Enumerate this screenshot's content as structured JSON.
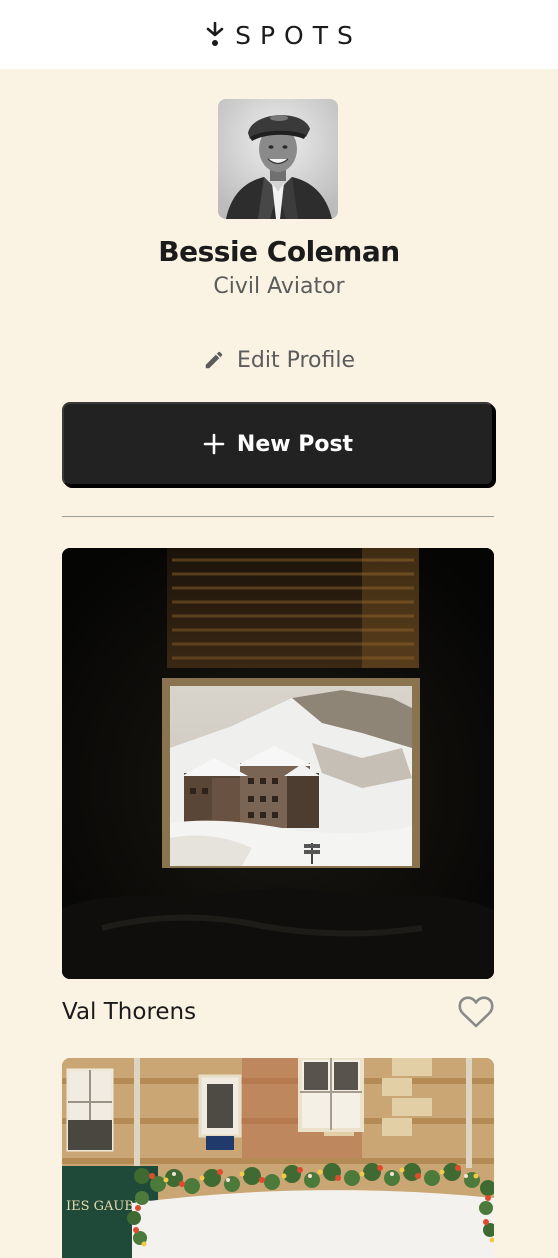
{
  "app": {
    "logo_text": "SPOTS",
    "logo_icon": "spots-logo-mark"
  },
  "profile": {
    "name": "Bessie Coleman",
    "description": "Civil Aviator",
    "edit_label": "Edit Profile",
    "edit_icon": "pencil-icon"
  },
  "actions": {
    "new_post_label": "New Post",
    "new_post_icon": "plus-icon"
  },
  "cards": [
    {
      "title": "Val Thorens",
      "image": "snowy-ski-resort-through-window",
      "liked": false,
      "like_icon": "heart-outline-icon"
    },
    {
      "title": "",
      "image": "cafe-facade-with-flowers",
      "sign_text": "IES GAUBERT"
    }
  ],
  "colors": {
    "background": "#FAF3E3",
    "header": "#FFFFFF",
    "text_primary": "#1B1B1B",
    "text_secondary": "#5C5C5C",
    "button_bg": "#222222",
    "divider": "#9EA097"
  }
}
